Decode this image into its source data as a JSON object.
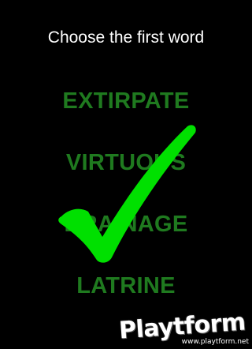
{
  "prompt": "Choose the first word",
  "words": [
    "EXTIRPATE",
    "VIRTUOUS",
    "DRAINAGE",
    "LATRINE"
  ],
  "feedback_icon": "checkmark-icon",
  "colors": {
    "background": "#000000",
    "prompt_text": "#ffffff",
    "word_text": "#1f7a1f",
    "checkmark": "#00e000"
  },
  "watermark": {
    "logo": "Playtform",
    "url": "www.playtform.net"
  }
}
